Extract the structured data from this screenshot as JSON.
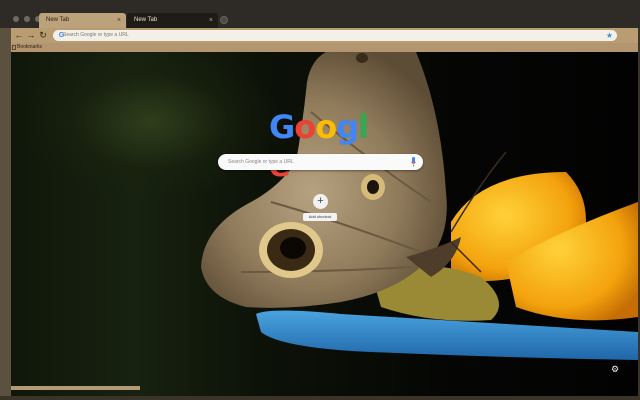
{
  "tabs": [
    {
      "title": "New Tab",
      "close": "×",
      "active": false
    },
    {
      "title": "New Tab",
      "close": "×",
      "active": true
    }
  ],
  "toolbar": {
    "back_icon": "arrow-left-icon",
    "forward_icon": "arrow-right-icon",
    "reload_icon": "reload-icon",
    "back_glyph": "←",
    "forward_glyph": "→",
    "reload_glyph": "↻"
  },
  "omnibox": {
    "g_glyph": "G",
    "placeholder": "Search Google or type a URL",
    "star_glyph": "★"
  },
  "bookmarks": {
    "items": [
      {
        "label": "Bookmarks"
      }
    ]
  },
  "ntp": {
    "logo": [
      "G",
      "o",
      "o",
      "g",
      "l",
      "e"
    ],
    "logo_colors": [
      "#4285f4",
      "#ea4335",
      "#fbbc05",
      "#4285f4",
      "#34a853",
      "#ea4335"
    ],
    "search_placeholder": "Search Google or type a URL",
    "shortcut": {
      "plus_glyph": "+",
      "label": "Add shortcut"
    },
    "settings_glyph": "⚙"
  },
  "theme": {
    "frame": "#2e2b26",
    "toolbar": "#b89c72",
    "active_tab": "#1f1c18"
  }
}
